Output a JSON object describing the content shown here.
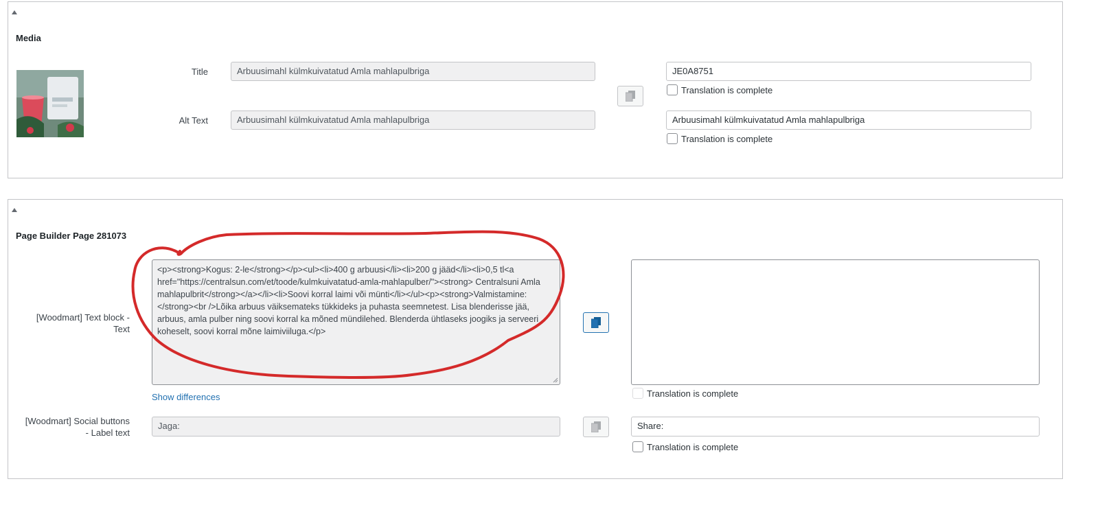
{
  "media": {
    "title": "Media",
    "title_label": "Title",
    "title_original": "Arbuusimahl külmkuivatatud Amla mahlapulbriga",
    "title_translation": "JE0A8751",
    "alt_label": "Alt Text",
    "alt_original": "Arbuusimahl külmkuivatatud Amla mahlapulbriga",
    "alt_translation": "Arbuusimahl külmkuivatatud Amla mahlapulbriga",
    "translation_complete_label": "Translation is complete",
    "thumbnail_icon": "product-photo"
  },
  "builder": {
    "title": "Page Builder Page 281073",
    "text_block_label": "[Woodmart] Text block - Text",
    "text_block_original": "<p><strong>Kogus: 2-le</strong></p><ul><li>400 g arbuusi</li><li>200 g jääd</li><li>0,5 tl<a href=\"https://centralsun.com/et/toode/kulmkuivatatud-amla-mahlapulber/\"><strong> Centralsuni Amla mahlapulbrit</strong></a></li><li>Soovi korral laimi või münti</li></ul><p><strong>Valmistamine:</strong><br />Lõika arbuus väiksemateks tükkideks ja puhasta seemnetest. Lisa blenderisse jää, arbuus, amla pulber ning soovi korral ka mõned mündilehed. Blenderda ühtlaseks joogiks ja serveeri koheselt, soovi korral mõne laimiviiluga.</p>",
    "text_block_translation": "",
    "show_differences": "Show differences",
    "translation_complete_label": "Translation is complete",
    "social_label": "[Woodmart] Social buttons - Label text",
    "social_original": "Jaga:",
    "social_translation": "Share:"
  },
  "colors": {
    "annotation": "#d42a2a",
    "link": "#2271b1",
    "readonly_bg": "#f0f0f1",
    "border": "#c3c4c7"
  }
}
